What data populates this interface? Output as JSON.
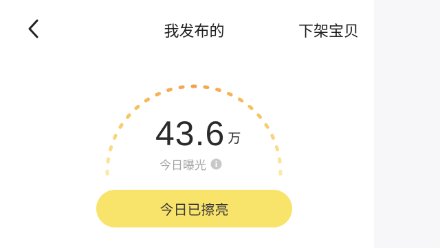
{
  "header": {
    "back_icon": "chevron-left-icon",
    "title": "我发布的",
    "takedown_label": "下架宝贝"
  },
  "exposure": {
    "value": "43.6",
    "unit": "万",
    "caption": "今日曝光",
    "info_icon": "info-circle-icon"
  },
  "action": {
    "shine_label": "今日已擦亮"
  },
  "colors": {
    "gauge_start": "#fbe9a6",
    "gauge_mid": "#f7c35a",
    "gauge_end": "#f5a04f",
    "button_bg": "#f9e46b"
  }
}
